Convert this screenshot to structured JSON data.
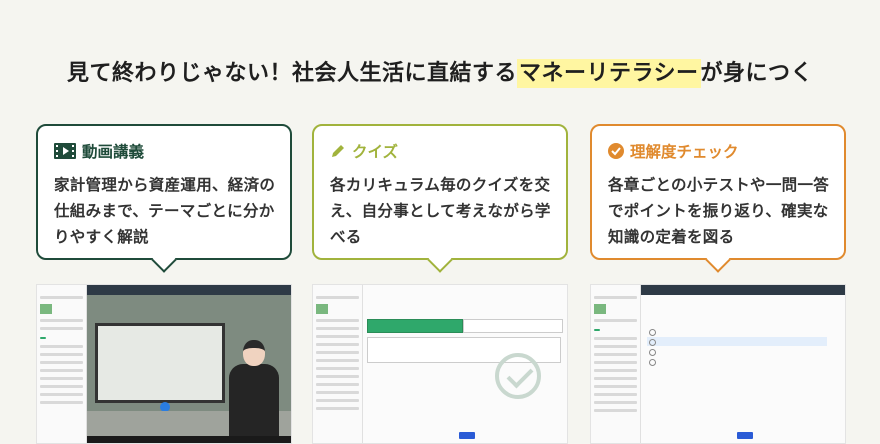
{
  "headline": {
    "before": "見て終わりじゃない！社会人生活に直結する",
    "highlight": "マネーリテラシー",
    "after": "が身につく"
  },
  "cards": [
    {
      "title": "動画講義",
      "icon": "film-icon",
      "body": "家計管理から資産運用、経済の仕組みまで、テーマごとに分かりやすく解説",
      "color": "#1f4b3a"
    },
    {
      "title": "クイズ",
      "icon": "pencil-icon",
      "body": "各カリキュラム毎のクイズを交え、自分事として考えながら学べる",
      "color": "#a1b33c"
    },
    {
      "title": "理解度チェック",
      "icon": "check-circle-icon",
      "body": "各章ごとの小テストや一問一答でポイントを振り返り、確実な知識の定着を図る",
      "color": "#e08a2e"
    }
  ]
}
